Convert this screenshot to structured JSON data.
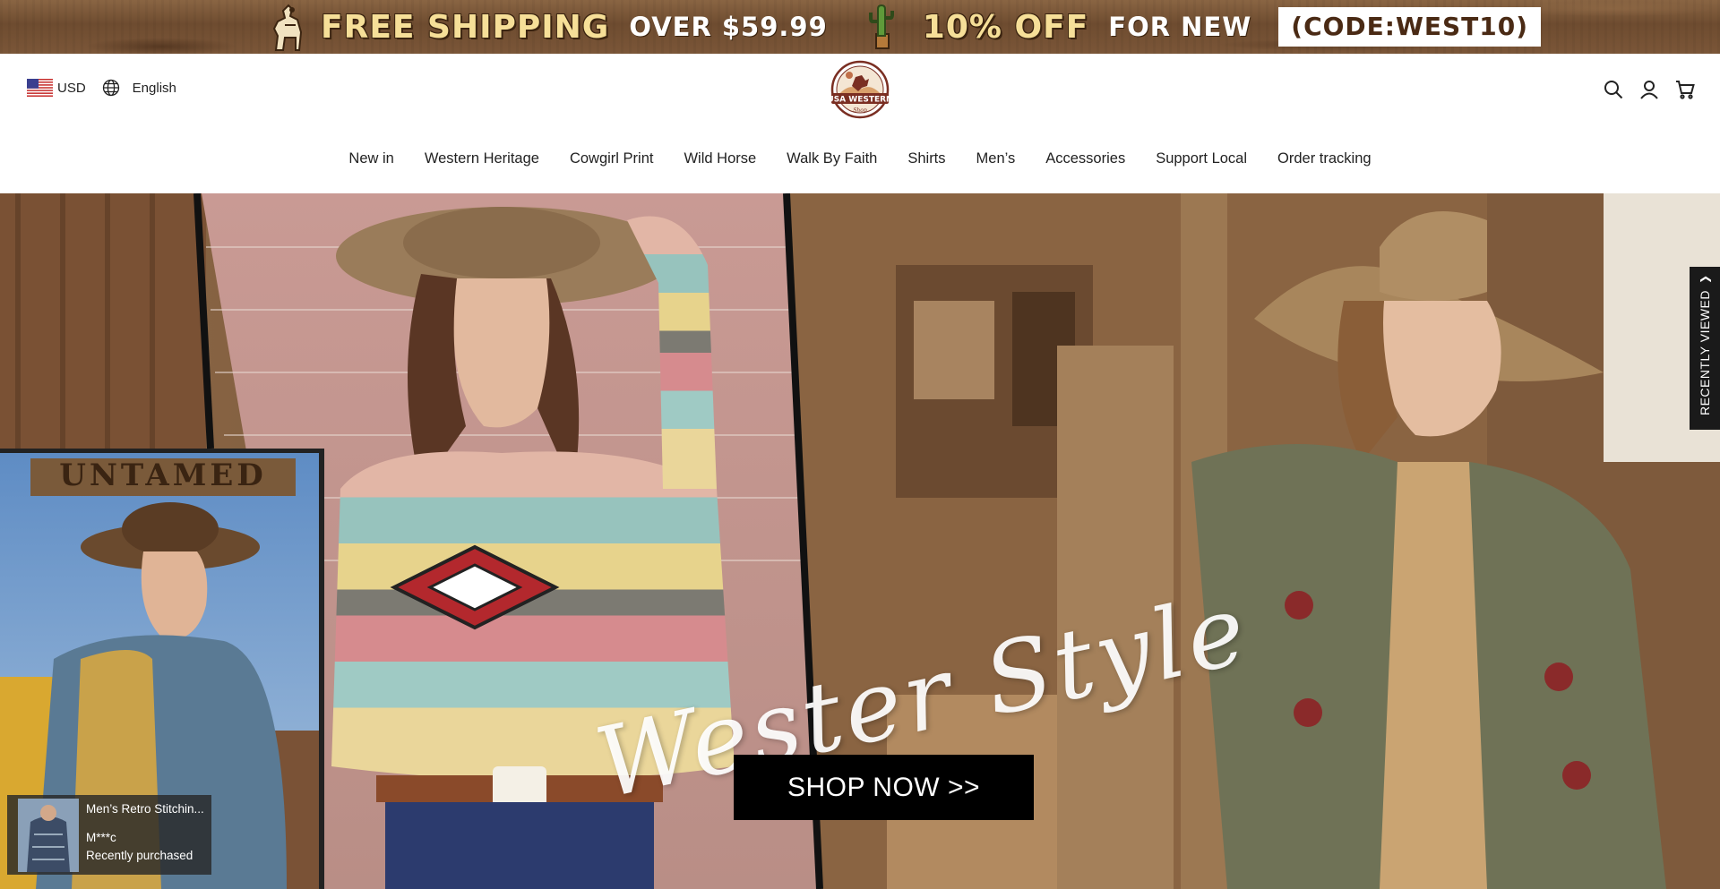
{
  "promo": {
    "free_shipping": "FREE SHIPPING",
    "threshold": "OVER $59.99",
    "discount": "10% OFF",
    "for_new": "FOR NEW",
    "code": "(CODE:WEST10)"
  },
  "header": {
    "currency": "USD",
    "language": "English",
    "logo_text": "USA WESTERN",
    "logo_sub": "Shop",
    "icons": [
      "search-icon",
      "account-icon",
      "cart-icon"
    ]
  },
  "nav": {
    "items": [
      "New in",
      "Western Heritage",
      "Cowgirl Print",
      "Wild Horse",
      "Walk By Faith",
      "Shirts",
      "Men’s",
      "Accessories",
      "Support Local",
      "Order tracking"
    ]
  },
  "hero": {
    "sign_text": "UNTAMED",
    "script_text": "Wester Style",
    "cta": "SHOP NOW >>"
  },
  "recently_viewed": {
    "label": "RECENTLY VIEWED"
  },
  "purchase_popup": {
    "product": "Men’s Retro Stitchin...",
    "buyer": "M***c",
    "status": "Recently purchased"
  },
  "colors": {
    "promo_bg": "#7b5638",
    "promo_gold": "#f6df98",
    "button_bg": "#000000",
    "logo_brown": "#7a2e22"
  }
}
